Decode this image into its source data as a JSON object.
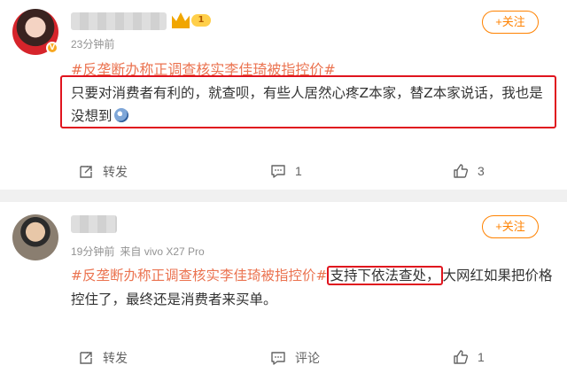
{
  "post1": {
    "time": "23分钟前",
    "level": "1",
    "follow_label": "+关注",
    "hashtag": "#反垄断办称正调查核实李佳琦被指控价#",
    "text": "只要对消费者有利的，就查呗，有些人居然心疼Z本家，替Z本家说话，我也是没想到",
    "actions": {
      "repost": "转发",
      "comment_count": "1",
      "like_count": "3"
    }
  },
  "post2": {
    "time": "19分钟前",
    "source": "来自 vivo X27 Pro",
    "follow_label": "+关注",
    "hashtag": "#反垄断办称正调查核实李佳琦被指控价#",
    "highlight": "支持下依法查处，",
    "text": "大网红如果把价格控住了，最终还是消费者来买单。",
    "actions": {
      "repost": "转发",
      "comment": "评论",
      "like_count": "1"
    }
  },
  "colors": {
    "accent": "#ff8200",
    "hashtag": "#eb7350",
    "highlight_box": "#e0141e"
  }
}
